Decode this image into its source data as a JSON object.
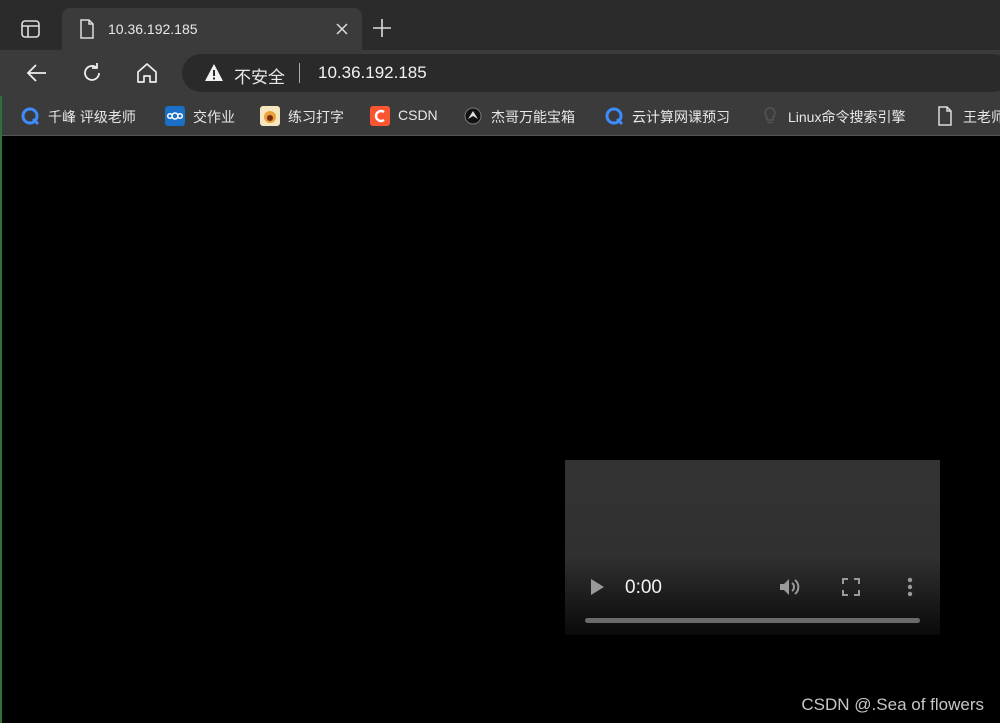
{
  "tab": {
    "title": "10.36.192.185"
  },
  "omnibox": {
    "security_label": "不安全",
    "url": "10.36.192.185"
  },
  "bookmarks": [
    {
      "label": "千峰 评级老师",
      "icon": "refresh-blue-icon"
    },
    {
      "label": "交作业",
      "icon": "nextcloud-icon"
    },
    {
      "label": "练习打字",
      "icon": "typing-app-icon"
    },
    {
      "label": "CSDN",
      "icon": "csdn-icon"
    },
    {
      "label": "杰哥万能宝箱",
      "icon": "eagle-icon"
    },
    {
      "label": "云计算网课预习",
      "icon": "refresh-blue-icon"
    },
    {
      "label": "Linux命令搜索引擎",
      "icon": "lightbulb-icon"
    },
    {
      "label": "王老师",
      "icon": "page-icon"
    }
  ],
  "video": {
    "time": "0:00",
    "progress": 0
  },
  "watermark": "CSDN @.Sea of flowers",
  "colors": {
    "chrome": "#3b3b3b",
    "tabstrip": "#2b2b2b",
    "page": "#000000",
    "csdn": "#fc5531",
    "blue": "#1a73e8"
  }
}
